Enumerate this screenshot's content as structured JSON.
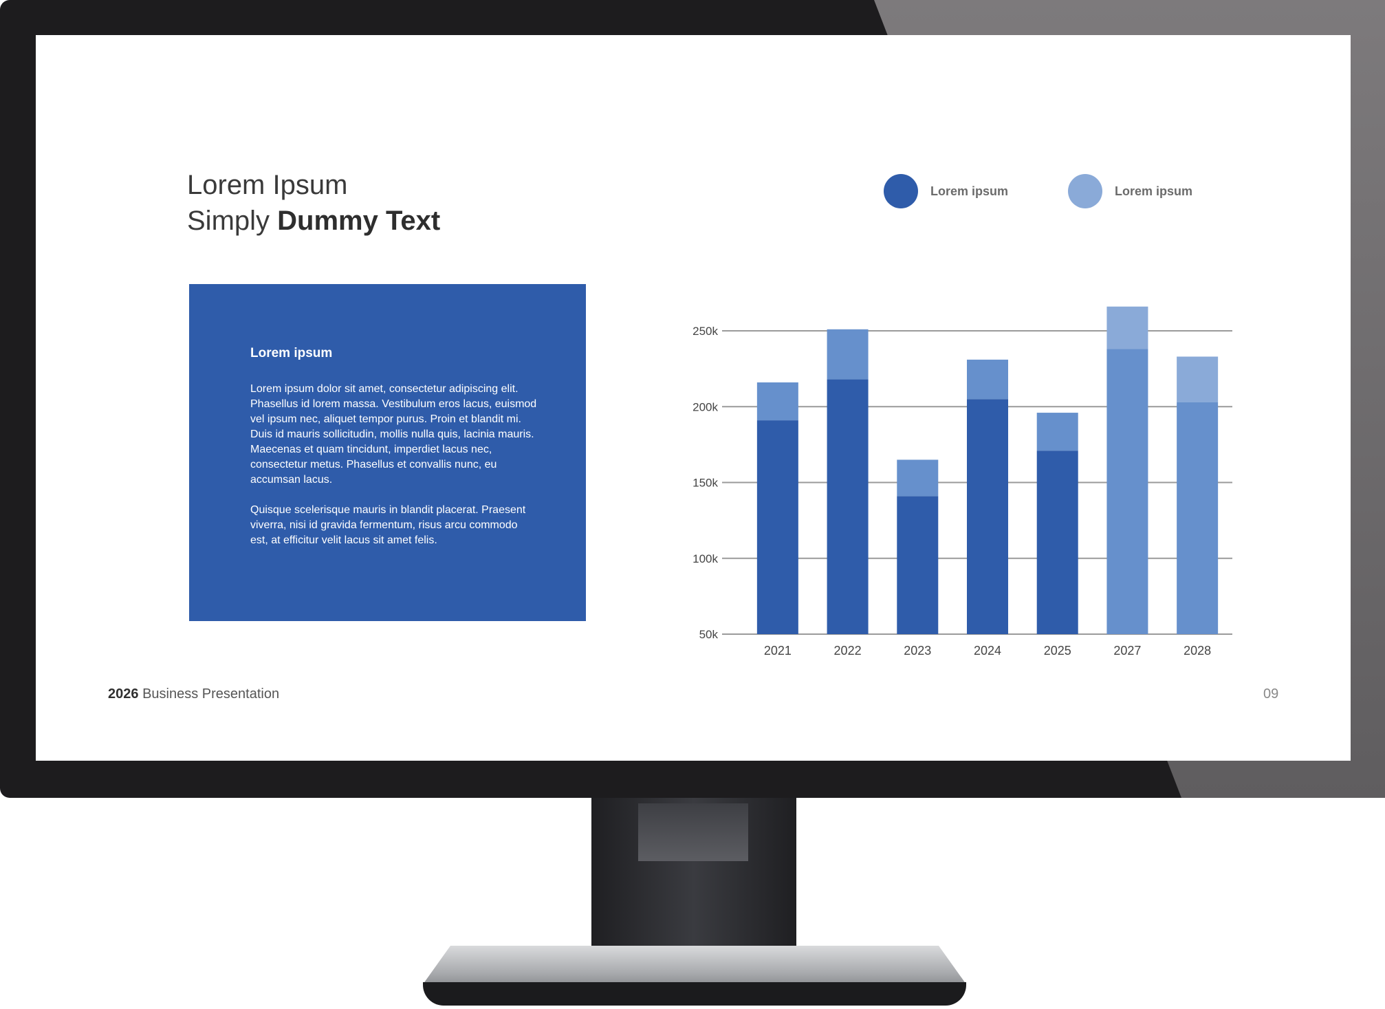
{
  "slide": {
    "title_line1": "Lorem Ipsum",
    "title_line2_light": "Simply",
    "title_line2_bold": "Dummy Text",
    "box_heading": "Lorem ipsum",
    "box_para1": "Lorem ipsum dolor sit amet, consectetur adipiscing elit. Phasellus id lorem massa. Vestibulum eros lacus, euismod vel ipsum nec, aliquet tempor purus. Proin et blandit mi. Duis id mauris sollicitudin, mollis nulla quis, lacinia mauris. Maecenas et quam tincidunt, imperdiet lacus nec, consectetur metus. Phasellus et convallis nunc, eu accumsan lacus.",
    "box_para2": "Quisque scelerisque mauris in blandit placerat. Praesent viverra, nisi id gravida fermentum, risus arcu commodo est, at efficitur velit lacus sit amet felis.",
    "footer_year": "2026",
    "footer_text": "Business Presentation",
    "page_number": "09"
  },
  "colors": {
    "dark_blue": "#2f5caa",
    "light_blue": "#8aaad8",
    "mid_blue": "#6690cc",
    "grid": "#9a9a9a",
    "axis_text": "#444444"
  },
  "chart_data": {
    "type": "bar",
    "stacked": true,
    "categories": [
      "2021",
      "2022",
      "2023",
      "2024",
      "2025",
      "2027",
      "2028"
    ],
    "series": [
      {
        "name": "Lorem ipsum",
        "values": [
          141,
          168,
          91,
          155,
          121,
          188,
          153
        ]
      },
      {
        "name": "Lorem ipsum",
        "values": [
          25,
          33,
          24,
          26,
          25,
          28,
          30
        ]
      }
    ],
    "y_ticks": [
      "250k",
      "200k",
      "150k",
      "100k",
      "50k"
    ],
    "ylim": [
      50,
      250
    ],
    "grid": true,
    "legend_position": "top-right"
  }
}
